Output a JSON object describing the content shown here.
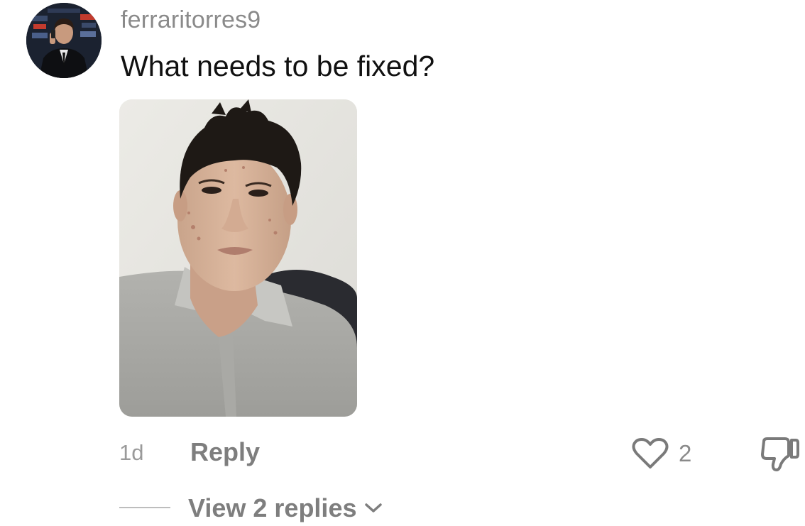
{
  "comment": {
    "username": "ferraritorres9",
    "text": "What needs to be fixed?",
    "timestamp": "1d",
    "reply_label": "Reply",
    "like_count": "2",
    "view_replies_label": "View 2 replies"
  },
  "icons": {
    "like": "heart-outline-icon",
    "dislike": "thumbs-down-outline-icon",
    "expand": "chevron-down-icon"
  },
  "colors": {
    "username": "#8a8a8a",
    "text": "#111111",
    "secondary": "#7e7e7e"
  }
}
